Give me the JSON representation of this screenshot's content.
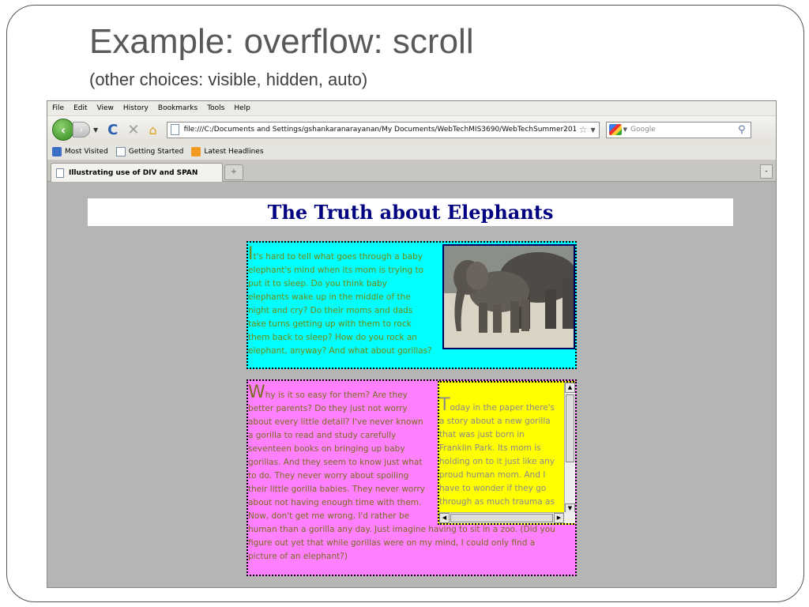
{
  "slide": {
    "title": "Example: overflow: scroll",
    "subtitle": "(other choices: visible, hidden, auto)"
  },
  "browser": {
    "menu": [
      "File",
      "Edit",
      "View",
      "History",
      "Bookmarks",
      "Tools",
      "Help"
    ],
    "url": "file:///C:/Documents and Settings/gshankaranarayanan/My Documents/WebTechMIS3690/WebTechSummer2010/CS3",
    "search_placeholder": "Google",
    "bookmarks": [
      "Most Visited",
      "Getting Started",
      "Latest Headlines"
    ],
    "tab_title": "Illustrating use of DIV and SPAN",
    "new_tab_symbol": "+",
    "tab_list_symbol": "-"
  },
  "page": {
    "heading": "The Truth about Elephants",
    "cyan": {
      "first_letter": "I",
      "lines": [
        "t's hard to tell what goes through a baby",
        "elephant's mind when its mom is trying to",
        "put it to sleep. Do you think baby",
        "elephants wake up in the middle of the",
        "night and cry? Do their moms and dads",
        "take turns getting up with them to rock",
        "them back to sleep? How do you rock an",
        "elephant, anyway? And what about gorillas?"
      ]
    },
    "pink": {
      "first_letter": "W",
      "lines": [
        "hy is it so easy for them? Are they",
        "better parents? Do they just not worry",
        "about every little detail? I've never known",
        "a gorilla to read and study carefully",
        "seventeen books on bringing up baby",
        "gorillas. And they seem to know just what",
        "to do. They never worry about spoiling",
        "their little gorilla babies. They never worry",
        "about not having enough time with them.",
        "Now, don't get me wrong, I'd rather be",
        "human than a gorilla any day. Just imagine having to sit in a zoo. (Did you",
        "figure out yet that while gorillas were on my mind, I could only find a",
        "picture of an elephant?)"
      ]
    },
    "yellow": {
      "first_letter": "T",
      "lines": [
        "oday in the paper there's",
        "a story about a new gorilla",
        "that was just born in",
        "Franklin Park. Its mom is",
        "holding on to it just like any",
        "proud human mom. And I",
        "have to wonder if they go",
        "through as much trauma as"
      ]
    }
  },
  "colors": {
    "cyan_bg": "#00ffff",
    "pink_bg": "#ff80ff",
    "yellow_bg": "#ffff00",
    "heading_color": "#000080",
    "content_bg": "#b5b5b5"
  }
}
